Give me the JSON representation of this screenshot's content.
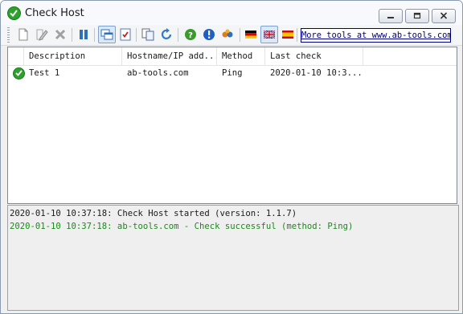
{
  "window": {
    "title": "Check Host",
    "controls": [
      {
        "name": "minimize-button",
        "icon": "minimize-icon"
      },
      {
        "name": "maximize-button",
        "icon": "maximize-icon"
      },
      {
        "name": "close-button",
        "icon": "close-icon"
      }
    ]
  },
  "toolbar": {
    "buttons": [
      {
        "name": "new-check-button",
        "icon": "new-document-icon"
      },
      {
        "name": "edit-check-button",
        "icon": "edit-icon"
      },
      {
        "name": "delete-check-button",
        "icon": "delete-icon"
      },
      {
        "name": "pause-button",
        "icon": "pause-icon"
      },
      {
        "name": "show-log-button",
        "icon": "windows-icon",
        "selected": true
      },
      {
        "name": "check-list-button",
        "icon": "checklist-icon"
      },
      {
        "name": "copy-button",
        "icon": "copy-icon"
      },
      {
        "name": "refresh-button",
        "icon": "refresh-icon"
      },
      {
        "name": "help-button",
        "icon": "help-icon"
      },
      {
        "name": "info-button",
        "icon": "info-icon"
      },
      {
        "name": "tools-button",
        "icon": "tools-icon"
      },
      {
        "name": "lang-german-button",
        "icon": "flag-germany-icon"
      },
      {
        "name": "lang-english-button",
        "icon": "flag-uk-icon",
        "selected": true
      },
      {
        "name": "lang-spanish-button",
        "icon": "flag-spain-icon"
      }
    ],
    "link_text": "More tools at www.ab-tools.com"
  },
  "table": {
    "columns": [
      "Description",
      "Hostname/IP add...",
      "Method",
      "Last check"
    ],
    "rows": [
      {
        "status": "ok",
        "status_icon": "check-circle-icon",
        "description": "Test 1",
        "hostname": "ab-tools.com",
        "method": "Ping",
        "last_check": "2020-01-10 10:3..."
      }
    ]
  },
  "log": {
    "lines": [
      {
        "text": "2020-01-10 10:37:18: Check Host started (version: 1.1.7)",
        "color": "#1a1a1a"
      },
      {
        "text": "2020-01-10 10:37:18: ab-tools.com - Check successful (method: Ping)",
        "color": "#1a8a1a"
      }
    ]
  },
  "colors": {
    "accent_link": "#000080",
    "success_green": "#2ea02e",
    "log_success": "#1a8a1a"
  }
}
